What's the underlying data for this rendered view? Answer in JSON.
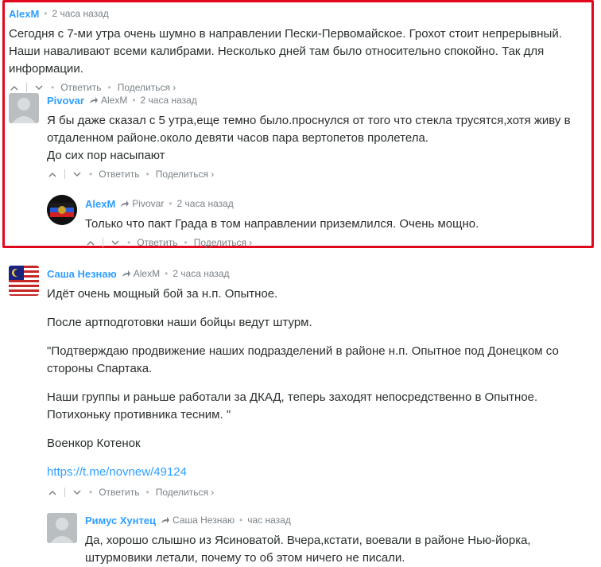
{
  "c1": {
    "author": "AlexM",
    "time": "2 часа назад",
    "text": "Сегодня с 7-ми утра очень шумно в направлении Пески-Первомайское. Грохот стоит непрерывный. Наши наваливают всеми калибрами. Несколько дней там было относительно спокойно. Так для информации.",
    "reply": "Ответить",
    "share": "Поделиться ›"
  },
  "c2": {
    "author": "Pivovar",
    "reply_to": "AlexM",
    "time": "2 часа назад",
    "line1": "Я бы даже сказал с 5 утра,еще темно было.проснулся от того что стекла трусятся,хотя живу в отдаленном районе.около девяти часов пара вертопетов пролетела.",
    "line2": "До сих пор насыпают",
    "reply": "Ответить",
    "share": "Поделиться ›"
  },
  "c3": {
    "author": "AlexM",
    "reply_to": "Pivovar",
    "time": "2 часа назад",
    "text": "Только что пакт Града в том направлении приземлился. Очень мощно.",
    "reply": "Ответить",
    "share": "Поделиться ›"
  },
  "c4": {
    "author": "Саша Незнаю",
    "reply_to": "AlexM",
    "time": "2 часа назад",
    "p1": "Идёт очень мощный бой за н.п. Опытное.",
    "p2": "После артподготовки наши бойцы ведут штурм.",
    "p3": "\"Подтверждаю продвижение наших подразделений в районе н.п. Опытное под Донецком со стороны Спартака.",
    "p4": "Наши группы и раньше работали за ДКАД, теперь заходят непосредственно в Опытное. Потихоньку противника тесним. \"",
    "p5": "Военкор Котенок",
    "link": "https://t.me/novnew/49124",
    "reply": "Ответить",
    "share": "Поделиться ›"
  },
  "c5": {
    "author": "Римус Хунтец",
    "reply_to": "Саша Незнаю",
    "time": "час назад",
    "text": "Да, хорошо слышно из Ясиноватой. Вчера,кстати, воевали в районе Нью-йорка, штурмовики летали, почему то об этом ничего не писали."
  },
  "colors": {
    "author": "#2e9fff",
    "highlight": "#e1081e",
    "meta": "#7a8287"
  }
}
